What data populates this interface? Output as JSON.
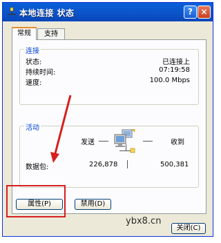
{
  "window": {
    "title": "本地连接 状态",
    "help_glyph": "?",
    "close_glyph": "×"
  },
  "tabs": [
    {
      "label": "常规",
      "active": true
    },
    {
      "label": "支持",
      "active": false
    }
  ],
  "connection": {
    "group_title": "连接",
    "rows": [
      {
        "label": "状态:",
        "value": "已连接上"
      },
      {
        "label": "持续时间:",
        "value": "07:19:58"
      },
      {
        "label": "速度:",
        "value": "100.0 Mbps"
      }
    ]
  },
  "activity": {
    "group_title": "活动",
    "sent_label": "发送",
    "received_label": "收到",
    "packets_label": "数据包:",
    "sent_value": "226,878",
    "received_value": "500,381"
  },
  "buttons": {
    "properties": "属性(P)",
    "disable": "禁用(D)",
    "close": "关闭(C)"
  },
  "watermark": "ybx8.cn",
  "colors": {
    "titlebar": "#0a5fd8",
    "group_title": "#0046d5",
    "annotation": "#d51f1f",
    "active_tab_accent": "#e68b2c"
  }
}
